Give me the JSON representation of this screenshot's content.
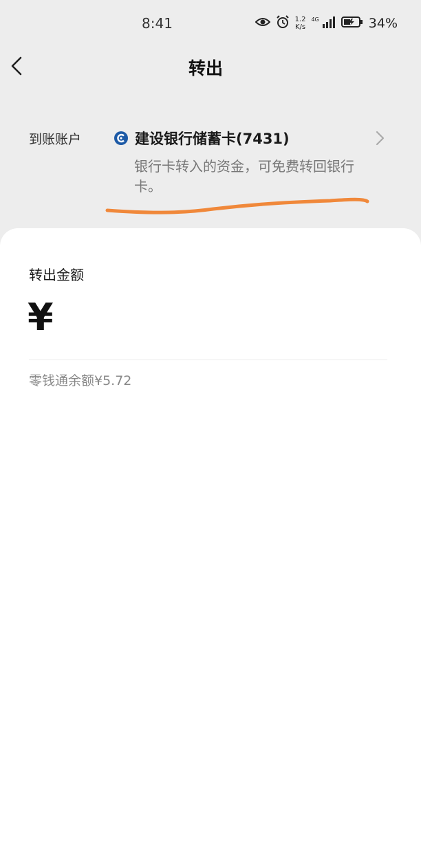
{
  "status_bar": {
    "time": "8:41",
    "net_speed_value": "1.2",
    "net_speed_unit": "K/s",
    "network_type": "4G",
    "battery": "34%"
  },
  "header": {
    "title": "转出"
  },
  "account": {
    "label": "到账账户",
    "bank_name": "建设银行储蓄卡(7431)",
    "note": "银行卡转入的资金，可免费转回银行卡。"
  },
  "amount": {
    "label": "转出金额",
    "currency_symbol": "¥",
    "balance_text": "零钱通余额¥5.72"
  },
  "colors": {
    "background": "#ededed",
    "card": "#ffffff",
    "annotation": "#f0883a",
    "bank_logo": "#1d5aa6"
  }
}
